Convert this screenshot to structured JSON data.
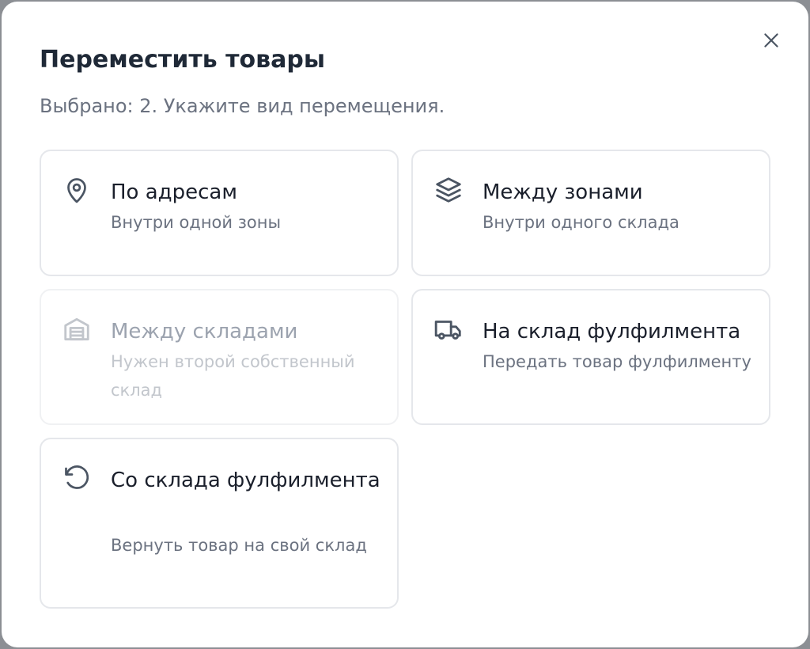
{
  "modal": {
    "title": "Переместить товары",
    "subtitle": "Выбрано: 2. Укажите вид перемещения.",
    "close_icon": "close-icon"
  },
  "options": [
    {
      "title": "По адресам",
      "description": "Внутри одной зоны",
      "icon": "map-pin-icon",
      "disabled": false
    },
    {
      "title": "Между зонами",
      "description": "Внутри одного склада",
      "icon": "layers-icon",
      "disabled": false
    },
    {
      "title": "Между складами",
      "description": "Нужен второй собственный склад",
      "icon": "warehouse-icon",
      "disabled": true
    },
    {
      "title": "На склад фулфилмента",
      "description": "Передать товар фулфилменту",
      "icon": "truck-icon",
      "disabled": false
    },
    {
      "title": "Со склада фулфилмента",
      "description": "Вернуть товар на свой склад",
      "icon": "rotate-ccw-icon",
      "disabled": false
    }
  ],
  "colors": {
    "text_primary": "#1a1f2b",
    "text_secondary": "#6b7280",
    "border": "#e5e7eb",
    "disabled_text": "#9ca3af",
    "icon": "#4b5563",
    "icon_disabled": "#c2c6cc"
  }
}
